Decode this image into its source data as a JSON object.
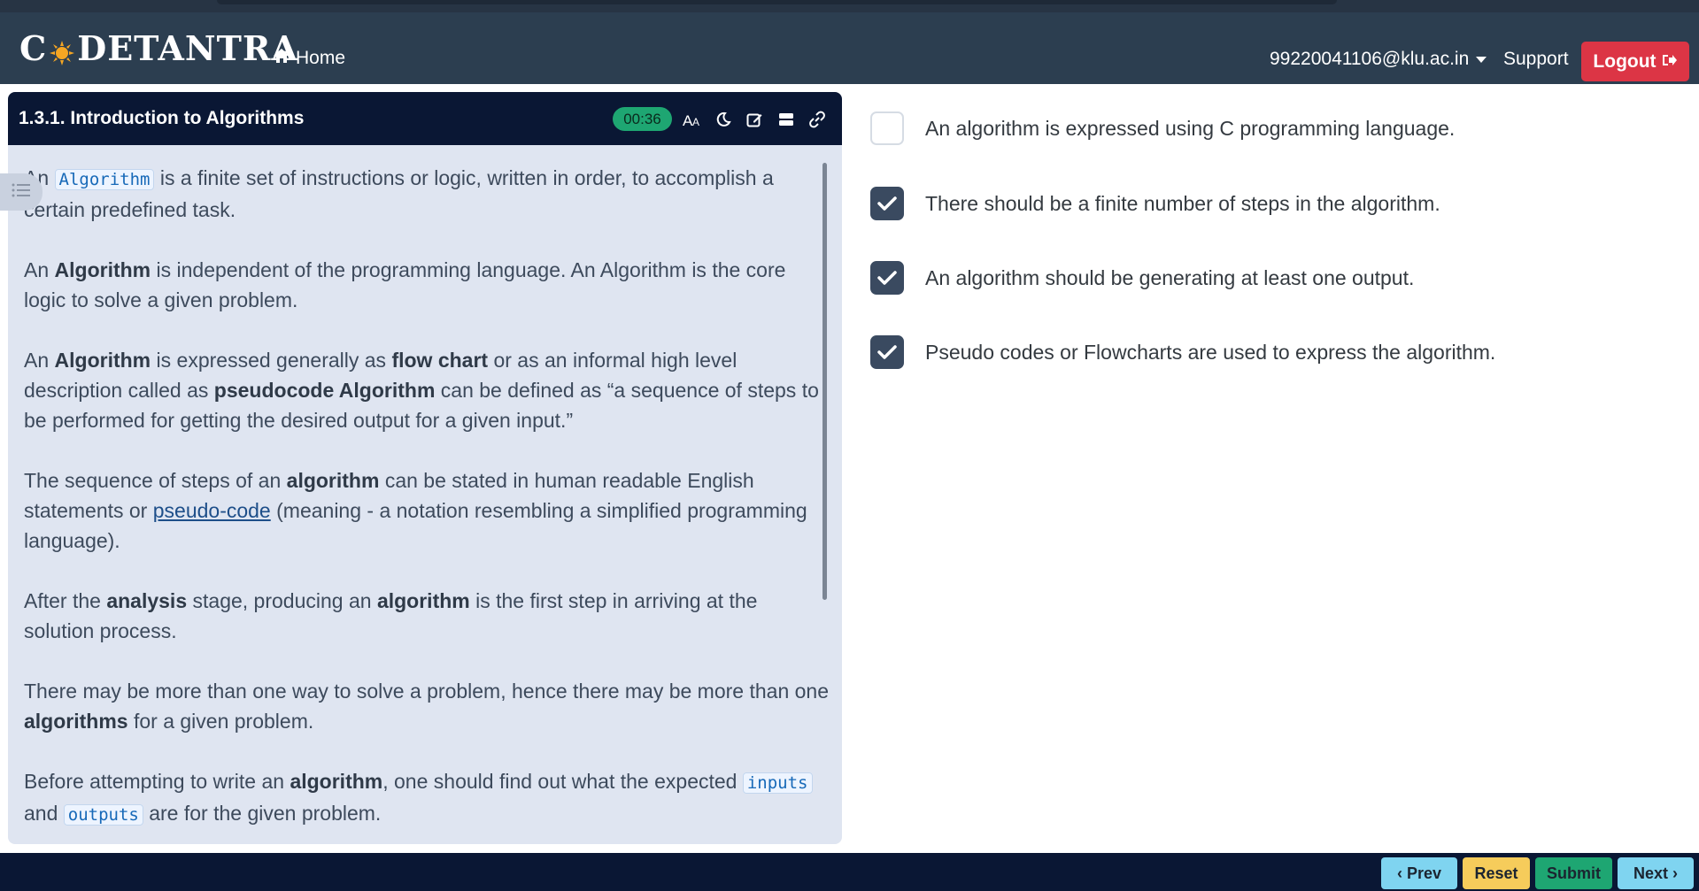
{
  "header": {
    "brand": "CODETANTRA",
    "home_label": "Home",
    "user_email": "99220041106@klu.ac.in",
    "support_label": "Support",
    "logout_label": "Logout"
  },
  "lesson": {
    "title": "1.3.1. Introduction to Algorithms",
    "timer": "00:36",
    "p1_a": "An",
    "p1_code": "Algorithm",
    "p1_b": "is a finite set of instructions or logic, written in order, to accomplish a certain predefined task.",
    "p2_a": "An",
    "p2_bold": "Algorithm",
    "p2_b": "is independent of the programming language. An Algorithm is the core logic to solve a given problem.",
    "p3_a": "An",
    "p3_bold1": "Algorithm",
    "p3_b": "is expressed generally as",
    "p3_bold2": "flow chart",
    "p3_c": "or as an informal high level description called as",
    "p3_bold3": "pseudocode Algorithm",
    "p3_d": "can be defined as “a sequence of steps to be performed for getting the desired output for a given input.”",
    "p4_a": "The sequence of steps of an",
    "p4_bold": "algorithm",
    "p4_b": "can be stated in human readable English statements or",
    "p4_link": "pseudo-code",
    "p4_c": "(meaning - a notation resembling a simplified programming language).",
    "p5_a": "After the",
    "p5_bold1": "analysis",
    "p5_b": "stage, producing an",
    "p5_bold2": "algorithm",
    "p5_c": "is the first step in arriving at the solution process.",
    "p6_a": "There may be more than one way to solve a problem, hence there may be more than one",
    "p6_bold": "algorithms",
    "p6_b": "for a given problem.",
    "p7_a": "Before attempting to write an",
    "p7_bold": "algorithm",
    "p7_b": ", one should find out what the expected",
    "p7_code1": "inputs",
    "p7_c": "and",
    "p7_code2": "outputs",
    "p7_d": "are for the given problem."
  },
  "options": [
    {
      "text": "An algorithm is expressed using C programming language.",
      "checked": false
    },
    {
      "text": "There should be a finite number of steps in the algorithm.",
      "checked": true
    },
    {
      "text": "An algorithm should be generating at least one output.",
      "checked": true
    },
    {
      "text": "Pseudo codes or Flowcharts are used to express the algorithm.",
      "checked": true
    }
  ],
  "footer": {
    "prev_label": "Prev",
    "reset_label": "Reset",
    "submit_label": "Submit",
    "next_label": "Next"
  },
  "colors": {
    "navbar": "#2c3e50",
    "logout": "#dc3545",
    "timer": "#1ea672",
    "checked": "#3a4a60"
  }
}
